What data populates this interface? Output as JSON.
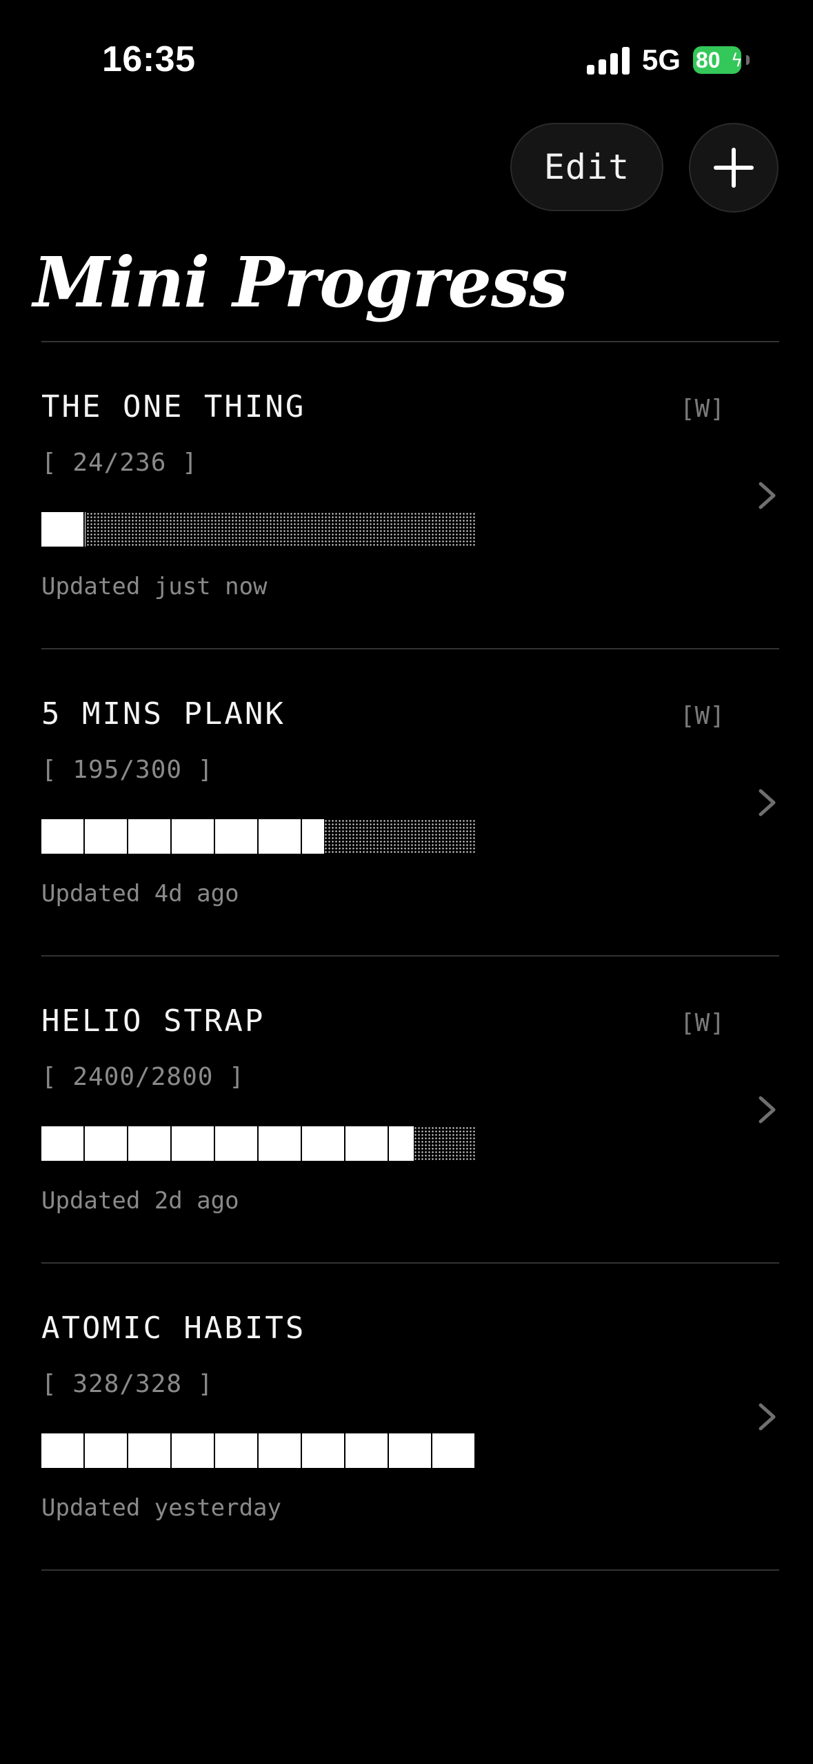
{
  "status_bar": {
    "time": "16:35",
    "network": "5G",
    "battery": "80"
  },
  "toolbar": {
    "edit_label": "Edit",
    "add_icon": "plus-icon"
  },
  "title": "Mini Progress",
  "items": [
    {
      "title": "THE ONE THING",
      "tag": "[W]",
      "count": "[ 24/236 ]",
      "current": 24,
      "total": 236,
      "updated": "Updated just now"
    },
    {
      "title": "5 MINS PLANK",
      "tag": "[W]",
      "count": "[ 195/300 ]",
      "current": 195,
      "total": 300,
      "updated": "Updated 4d ago"
    },
    {
      "title": "HELIO STRAP",
      "tag": "[W]",
      "count": "[ 2400/2800 ]",
      "current": 2400,
      "total": 2800,
      "updated": "Updated 2d ago"
    },
    {
      "title": "ATOMIC HABITS",
      "tag": "",
      "count": "[ 328/328 ]",
      "current": 328,
      "total": 328,
      "updated": "Updated yesterday"
    }
  ],
  "colors": {
    "background": "#000000",
    "text": "#ffffff",
    "muted": "#8a8a8a",
    "battery": "#34c759"
  }
}
